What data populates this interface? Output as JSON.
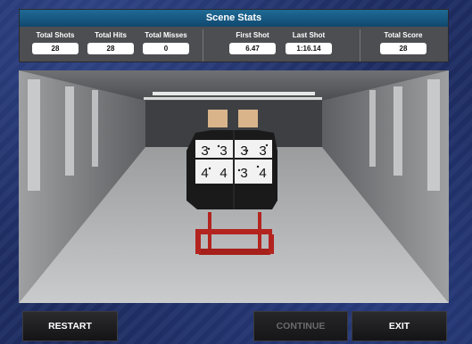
{
  "header": {
    "title": "Scene Stats"
  },
  "stats": {
    "total_shots": {
      "label": "Total Shots",
      "value": "28"
    },
    "total_hits": {
      "label": "Total Hits",
      "value": "28"
    },
    "total_misses": {
      "label": "Total Misses",
      "value": "0"
    },
    "first_shot": {
      "label": "First Shot",
      "value": "6.47"
    },
    "last_shot": {
      "label": "Last Shot",
      "value": "1:16.14"
    },
    "total_score": {
      "label": "Total Score",
      "value": "28"
    }
  },
  "target": {
    "top_row": [
      "3",
      "3",
      "3",
      "3"
    ],
    "bottom_row": [
      "4",
      "4",
      "3",
      "4"
    ]
  },
  "buttons": {
    "restart": "RESTART",
    "continue": "CONTINUE",
    "exit": "EXIT"
  },
  "colors": {
    "header_bar": "#15577f",
    "panel": "#4d4e52",
    "target_stand": "#b3241f",
    "background": "#1e2d63"
  }
}
